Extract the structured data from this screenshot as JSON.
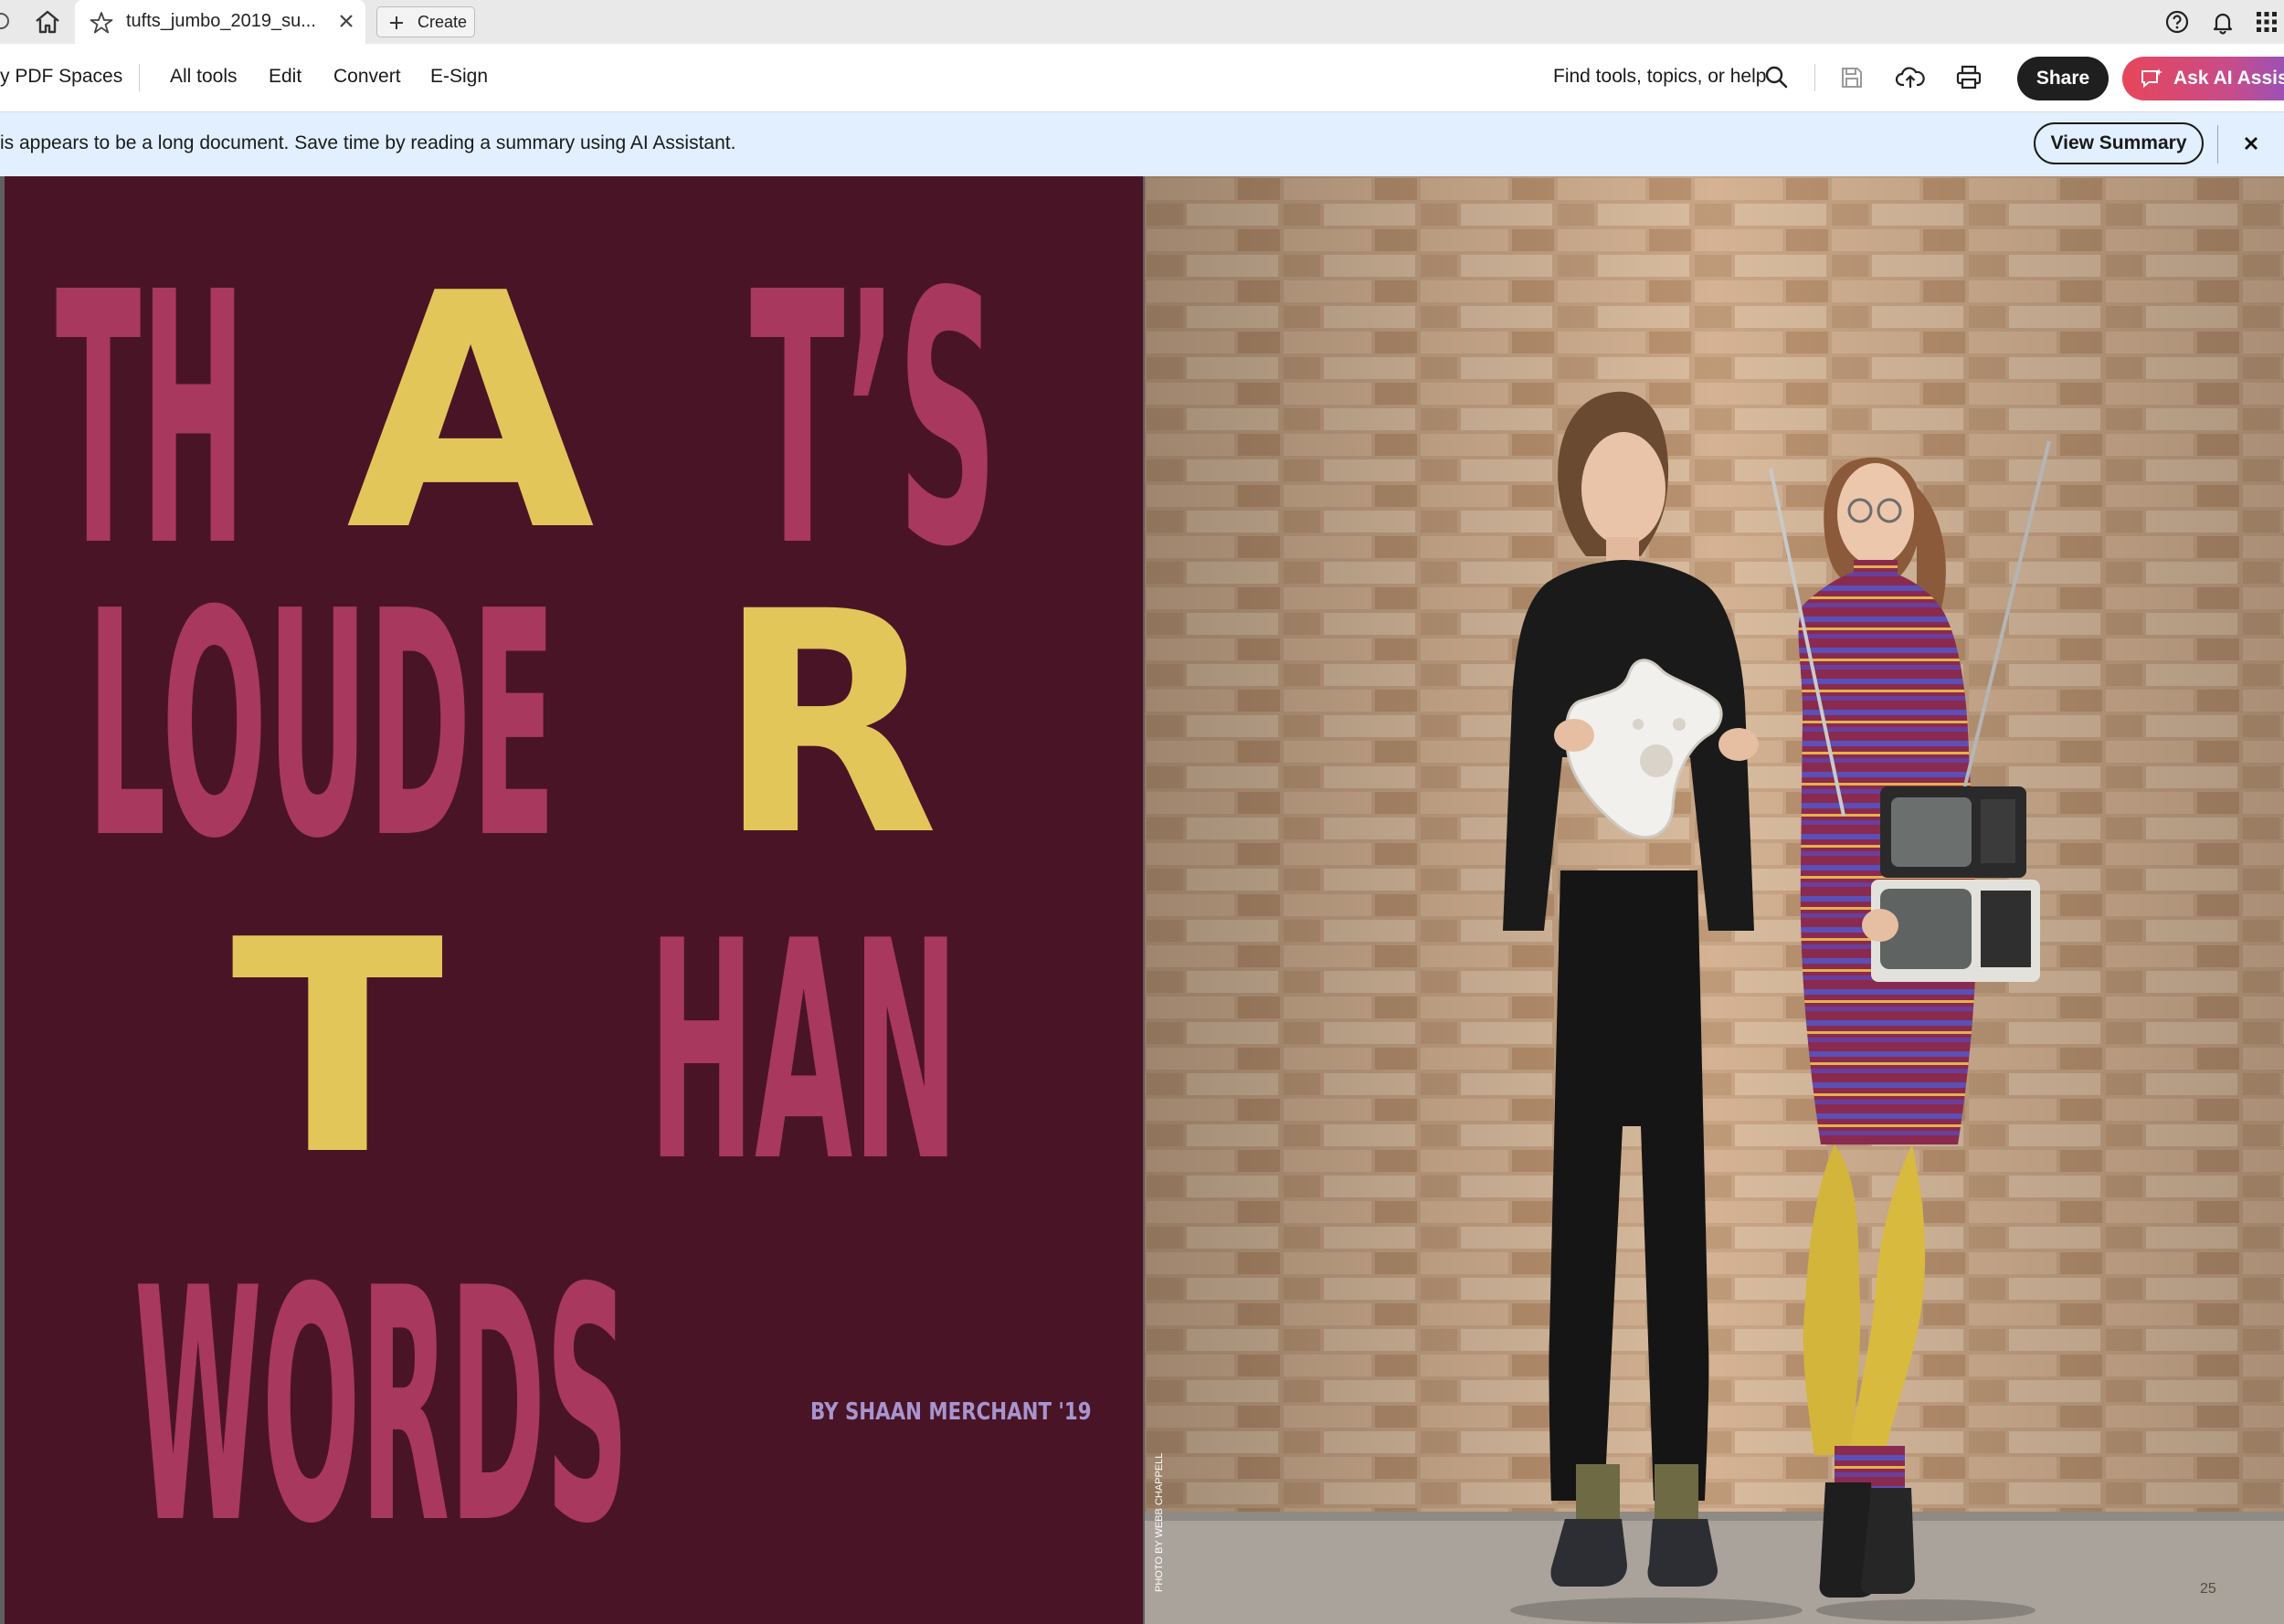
{
  "tabbar": {
    "tab_title": "tufts_jumbo_2019_su...",
    "create_label": "Create"
  },
  "menubar": {
    "pdf_spaces": "y PDF Spaces",
    "all_tools": "All tools",
    "edit": "Edit",
    "convert": "Convert",
    "esign": "E-Sign",
    "find_placeholder": "Find tools, topics, or help",
    "share_label": "Share",
    "ai_label": "Ask AI Assistant"
  },
  "notice": {
    "message": "is appears to be a long document. Save time by reading a summary using AI Assistant.",
    "view_summary": "View Summary"
  },
  "article": {
    "line1": [
      "TH",
      "A",
      "T’S"
    ],
    "line2": [
      "LOUDE",
      "R"
    ],
    "line3": [
      "T",
      "HAN"
    ],
    "line4": "WORDS",
    "byline": "BY SHAAN MERCHANT '19",
    "photo_credit": "PHOTO BY WEBB CHAPPELL",
    "page_number": "25"
  },
  "colors": {
    "page_bg": "#4a1427",
    "headline_pink": "#a8385e",
    "headline_gold": "#e3c65a",
    "byline": "#a695ce",
    "notice_bg": "#e1efff"
  }
}
